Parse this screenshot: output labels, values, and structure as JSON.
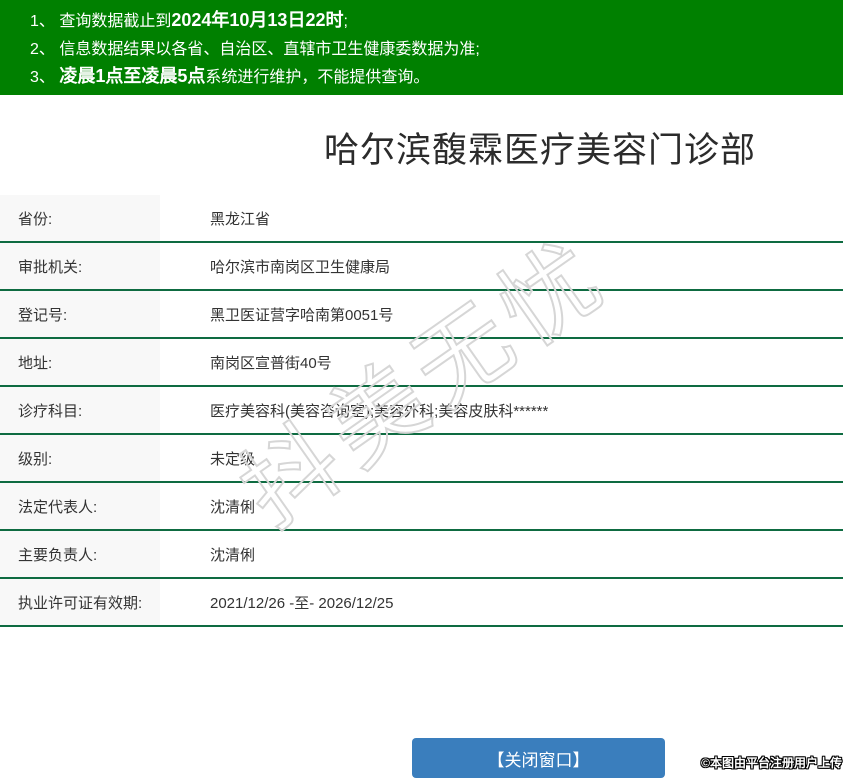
{
  "banner": {
    "lines": [
      {
        "prefix": "1、 查询数据截止到",
        "bold": "2024年10月13日22时",
        "suffix": ";"
      },
      {
        "prefix": "2、 信息数据结果以各省、自治区、直辖市卫生健康委数据为准;",
        "bold": "",
        "suffix": ""
      },
      {
        "prefix": "3、 ",
        "bold": "凌晨1点至凌晨5点",
        "suffix": "系统进行维护，不能提供查询。"
      }
    ]
  },
  "title": "哈尔滨馥霖医疗美容门诊部",
  "table": {
    "rows": [
      {
        "label": "省份:",
        "value": "黑龙江省"
      },
      {
        "label": "审批机关:",
        "value": "哈尔滨市南岗区卫生健康局"
      },
      {
        "label": "登记号:",
        "value": "黑卫医证营字哈南第0051号"
      },
      {
        "label": "地址:",
        "value": "南岗区宣普街40号"
      },
      {
        "label": "诊疗科目:",
        "value": "医疗美容科(美容咨询室);美容外科;美容皮肤科******"
      },
      {
        "label": "级别:",
        "value": "未定级"
      },
      {
        "label": "法定代表人:",
        "value": "沈清俐"
      },
      {
        "label": "主要负责人:",
        "value": "沈清俐"
      },
      {
        "label": "执业许可证有效期:",
        "value": "2021/12/26 -至- 2026/12/25"
      }
    ]
  },
  "watermark": "抖美无忧",
  "close_button_label": "【关闭窗口】",
  "attribution": "©本图由平台注册用户上传",
  "colors": {
    "banner_green": "#008000",
    "separator_green": "#0e6b41",
    "label_bg": "#f8f8f8",
    "button_blue": "#3a7ebd",
    "watermark_gray": "#d6d6d6"
  }
}
